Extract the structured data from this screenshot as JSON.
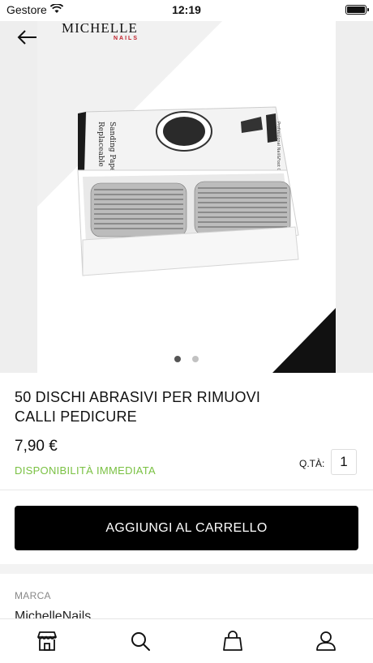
{
  "status_bar": {
    "carrier": "Gestore",
    "time": "12:19",
    "wifi_icon": "wifi-icon",
    "battery_icon": "battery-icon"
  },
  "header": {
    "back_icon": "arrow-left-icon",
    "logo_text": "MICHELLE",
    "logo_subtext": "NAILS"
  },
  "carousel": {
    "image_box_text_1": "Replaceable",
    "image_box_text_2": "Sanding Paper",
    "image_box_side_text": "Professional Nail&Foot Care",
    "page_count": 2,
    "active_index": 0
  },
  "product": {
    "title": "50 DISCHI ABRASIVI PER RIMUOVI CALLI PEDICURE",
    "price": "7,90 €",
    "availability": "DISPONIBILITÀ IMMEDIATA",
    "qty_label": "Q.TÀ:",
    "qty_value": "1"
  },
  "actions": {
    "add_to_cart_label": "AGGIUNGI AL CARRELLO"
  },
  "details": {
    "brand_label": "MARCA",
    "brand_value": "MichelleNails"
  },
  "tab_bar": {
    "items": [
      "store-icon",
      "search-icon",
      "shopping-bag-icon",
      "user-icon"
    ]
  },
  "colors": {
    "accent_green": "#7ac143",
    "button_bg": "#000000",
    "logo_red": "#c0202a"
  }
}
